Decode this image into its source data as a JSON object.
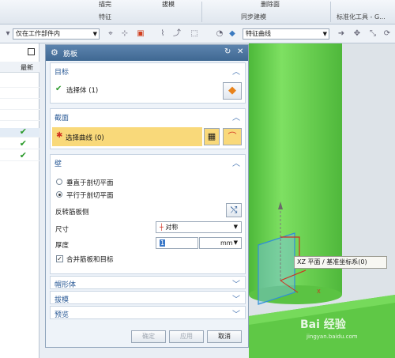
{
  "ribbon": {
    "items": [
      "描完",
      "拔模",
      "删除面",
      "标准化工具 - G..."
    ],
    "groups": [
      "特征",
      "同步建模",
      "标准化工具 - G..."
    ]
  },
  "toolbar": {
    "scope_select": "仅在工作部件内",
    "curve_rule_select": "特征曲线"
  },
  "left_panel": {
    "header": "最新",
    "checks": [
      "✔",
      "✔",
      "✔"
    ]
  },
  "dialog": {
    "title": "筋板",
    "target": {
      "header": "目标",
      "select_body": "选择体 (1)"
    },
    "section": {
      "header": "截面",
      "select_curve": "选择曲线 (0)"
    },
    "wall": {
      "header": "壁",
      "option_perpendicular": "垂直于剖切平面",
      "option_parallel": "平行于剖切平面",
      "selected_option": "option_parallel",
      "reverse_label": "反转筋板侧",
      "dimension_label": "尺寸",
      "dimension_value": "对称",
      "thickness_label": "厚度",
      "thickness_value": "1",
      "thickness_unit": "mm",
      "merge_label": "合并筋板和目标",
      "merge_checked": true
    },
    "collapsed_sections": [
      "帽形体",
      "拔模",
      "预览"
    ],
    "buttons": {
      "ok": "确定",
      "apply": "应用",
      "cancel": "取消"
    }
  },
  "tooltip": "XZ 平面 / 基准坐标系(0)",
  "watermark": {
    "brand": "Bai 经验",
    "url": "jingyan.baidu.com"
  },
  "colors": {
    "model_green": "#6ed352",
    "dialog_title_bar": "#4a73a0",
    "highlight_row": "#f9d97a",
    "section_header_text": "#2a5a96"
  }
}
